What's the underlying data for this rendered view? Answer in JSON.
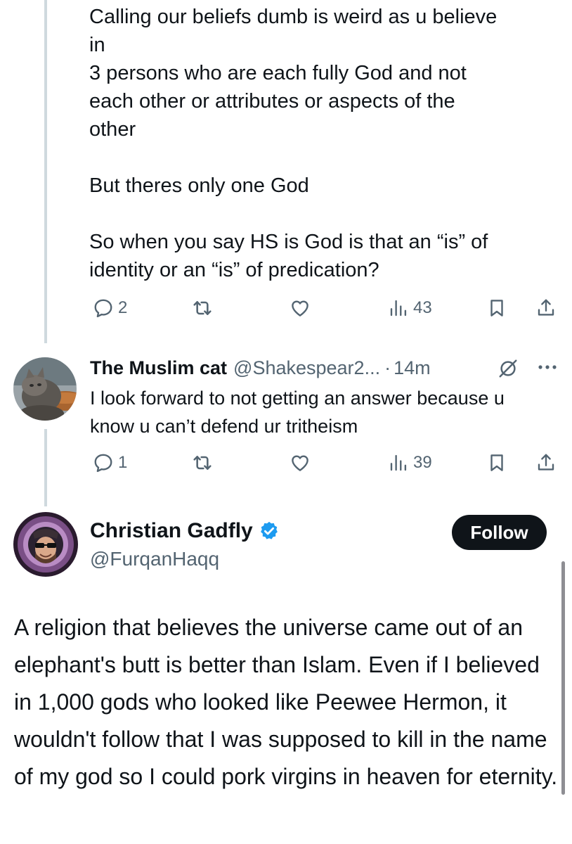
{
  "tweet1": {
    "text": "Calling our beliefs dumb is weird as u believe\nin\n3 persons who are each fully God and not\neach other or attributes or aspects of the\nother\n\nBut theres only one God\n\nSo when you say HS is God is that an “is” of\nidentity or an “is” of predication?",
    "replies": "2",
    "views": "43"
  },
  "tweet2": {
    "name": "The Muslim cat",
    "handle": "@Shakespear2...",
    "dot": "·",
    "time": "14m",
    "text": "I look forward to not getting an answer because u know u can’t defend ur tritheism",
    "replies": "1",
    "views": "39"
  },
  "tweet3": {
    "name": "Christian Gadfly",
    "handle": "@FurqanHaqq",
    "follow_label": "Follow",
    "text": "A religion that believes the universe came out of an elephant's butt is better than Islam. Even if I believed in 1,000 gods who looked like Peewee Hermon, it wouldn't follow that I was supposed to kill in the name of my god so I could pork virgins in heaven for eternity."
  },
  "colors": {
    "text": "#0f1419",
    "secondary": "#536471",
    "verified": "#1d9bf0",
    "thread_line": "#cfd9de",
    "follow_bg": "#0f1419"
  },
  "icons": [
    "reply-icon",
    "retweet-icon",
    "like-icon",
    "views-icon",
    "bookmark-icon",
    "share-icon",
    "grok-icon",
    "more-icon",
    "verified-badge-icon"
  ]
}
